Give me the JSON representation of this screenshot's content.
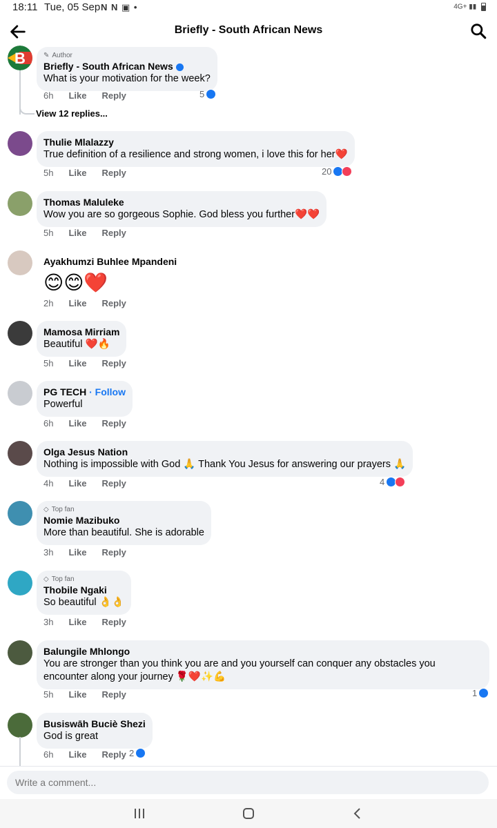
{
  "status": {
    "time": "18:11",
    "date": "Tue, 05 Sep",
    "notif": "N N",
    "network": "4G+"
  },
  "header": {
    "title": "Briefly - South African News"
  },
  "comments": [
    {
      "badge": "Author",
      "name": "Briefly - South African News",
      "text": "What is your motivation for the week?",
      "time": "6h",
      "like": "Like",
      "reply": "Reply",
      "reactions": "5",
      "view_replies": "View 12 replies..."
    },
    {
      "name": "Thulie Mlalazzy",
      "text": "True definition of a resilience and strong women, i love this for her❤️",
      "time": "5h",
      "like": "Like",
      "reply": "Reply",
      "reactions": "20"
    },
    {
      "name": "Thomas Maluleke",
      "text": "Wow you are so gorgeous  Sophie. God bless you further❤️❤️",
      "time": "5h",
      "like": "Like",
      "reply": "Reply"
    },
    {
      "name": "Ayakhumzi Buhlee Mpandeni",
      "text": "😊😊❤️",
      "time": "2h",
      "like": "Like",
      "reply": "Reply"
    },
    {
      "name": "Mamosa Mirriam",
      "text": "Beautiful ❤️🔥",
      "time": "5h",
      "like": "Like",
      "reply": "Reply"
    },
    {
      "name": "PG TECH",
      "follow": "· Follow",
      "text": "Powerful",
      "time": "6h",
      "like": "Like",
      "reply": "Reply"
    },
    {
      "name": "Olga Jesus Nation",
      "text": "Nothing is impossible with God 🙏 Thank You Jesus for answering our prayers 🙏",
      "time": "4h",
      "like": "Like",
      "reply": "Reply",
      "reactions": "4"
    },
    {
      "badge": "Top fan",
      "name": "Nomie Mazibuko",
      "text": "More than beautiful. She is adorable",
      "time": "3h",
      "like": "Like",
      "reply": "Reply"
    },
    {
      "badge": "Top fan",
      "name": "Thobile Ngaki",
      "text": "So beautiful 👌👌",
      "time": "3h",
      "like": "Like",
      "reply": "Reply"
    },
    {
      "name": "Balungile Mhlongo",
      "text": "You are stronger than you think you are and you yourself can conquer any obstacles you encounter along your journey 🌹❤️✨💪",
      "time": "5h",
      "like": "Like",
      "reply": "Reply",
      "reactions": "1"
    },
    {
      "name": "Busiswāh Buciè Shezi",
      "text": "God is great",
      "time": "6h",
      "like": "Like",
      "reply": "Reply",
      "reactions": "2"
    }
  ],
  "composer": {
    "placeholder": "Write a comment..."
  },
  "colors": {
    "accent": "#1877f2",
    "love": "#f33e58",
    "bubble": "#f0f2f5"
  }
}
